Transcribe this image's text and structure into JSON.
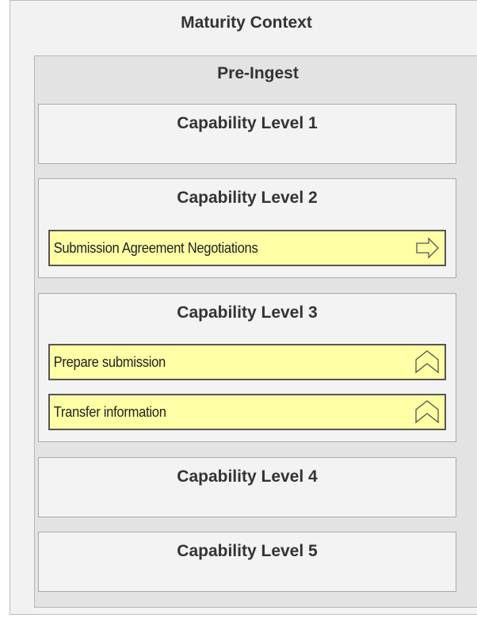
{
  "diagram": {
    "title": "Maturity Context",
    "group": {
      "title": "Pre-Ingest",
      "levels": [
        {
          "title": "Capability Level 1",
          "items": []
        },
        {
          "title": "Capability Level 2",
          "items": [
            {
              "label": "Submission Agreement Negotiations",
              "icon": "arrow-right-icon"
            }
          ]
        },
        {
          "title": "Capability Level 3",
          "items": [
            {
              "label": "Prepare submission",
              "icon": "chevron-up-icon"
            },
            {
              "label": "Transfer information",
              "icon": "chevron-up-icon"
            }
          ]
        },
        {
          "title": "Capability Level 4",
          "items": []
        },
        {
          "title": "Capability Level 5",
          "items": []
        }
      ]
    },
    "colors": {
      "item_fill": "#ffffa6",
      "item_border": "#555555",
      "level_fill": "#f3f3f3",
      "group_fill": "#e3e3e3",
      "outer_fill": "#f2f2f2"
    }
  }
}
